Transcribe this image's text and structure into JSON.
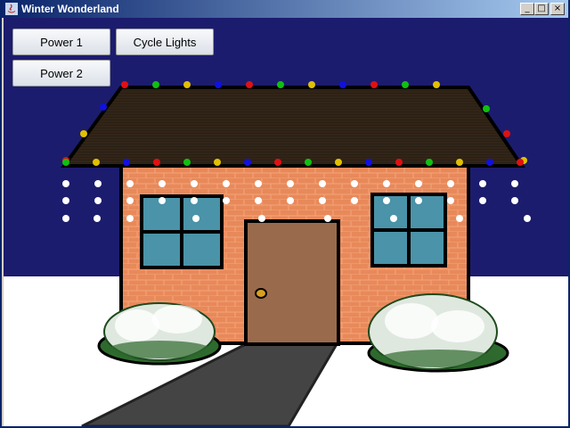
{
  "window": {
    "title": "Winter Wonderland"
  },
  "buttons": {
    "power1": "Power 1",
    "cycle": "Cycle Lights",
    "power2": "Power 2"
  },
  "scene": {
    "sky_color": "#1c1c6e",
    "snow_color": "#ffffff",
    "roof_color": "#2a1f14",
    "wall_color": "#e8895a",
    "door_color": "#9a6a4c",
    "window_glass_color": "#4a93a8",
    "path_color": "#444444",
    "bush_color": "#2e6a2e",
    "light_colors": [
      "#e01010",
      "#1010e0",
      "#10c010",
      "#e0c000",
      "#ffffff"
    ]
  }
}
